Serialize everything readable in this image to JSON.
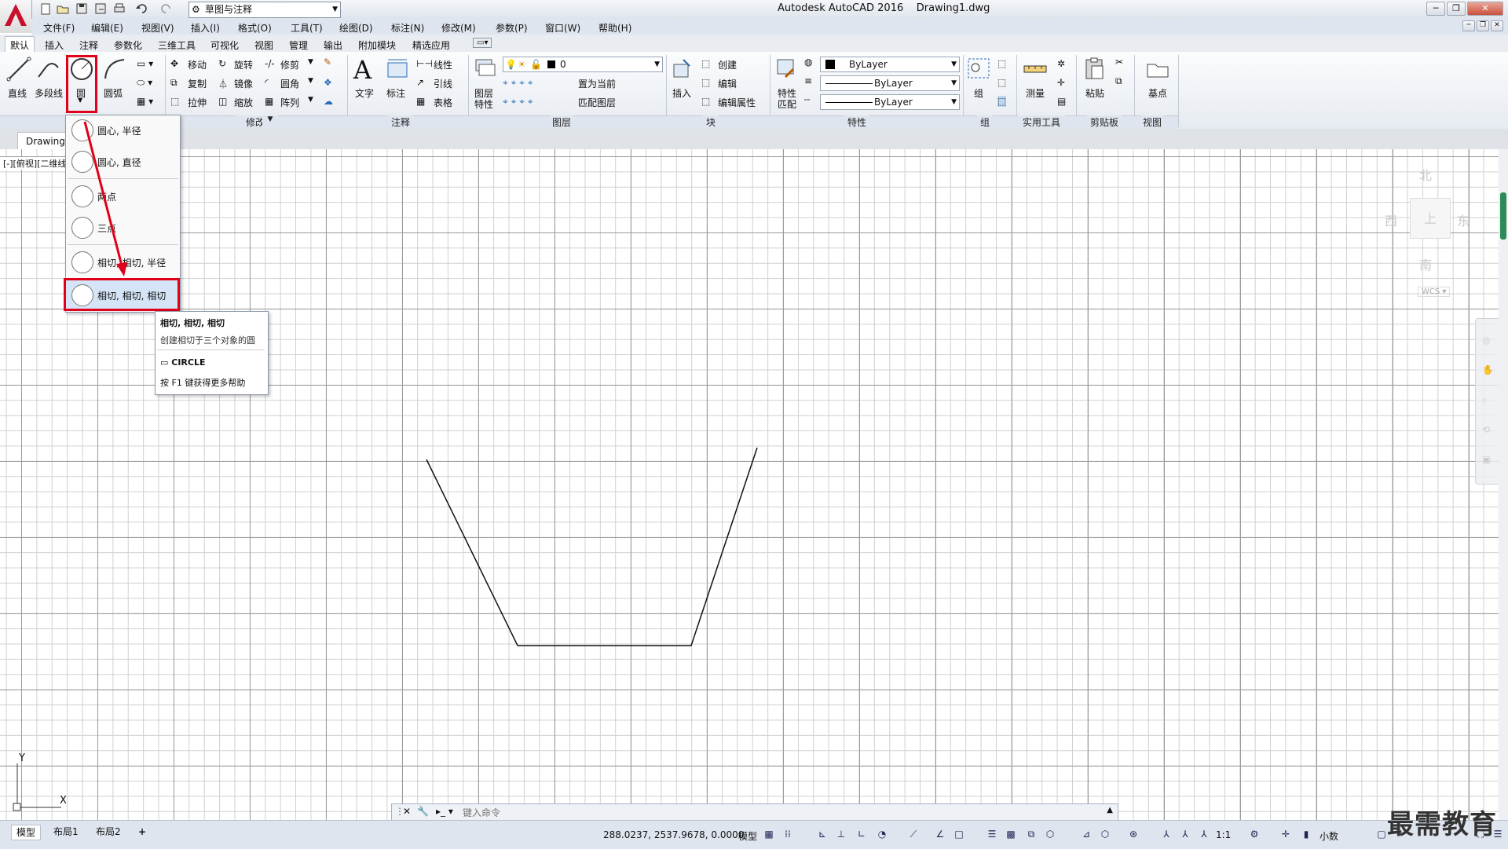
{
  "window": {
    "app_title": "Autodesk AutoCAD 2016",
    "file_name": "Drawing1.dwg",
    "workspace": "草图与注释"
  },
  "menu": [
    "文件(F)",
    "编辑(E)",
    "视图(V)",
    "插入(I)",
    "格式(O)",
    "工具(T)",
    "绘图(D)",
    "标注(N)",
    "修改(M)",
    "参数(P)",
    "窗口(W)",
    "帮助(H)"
  ],
  "ribbon_tabs": [
    "默认",
    "插入",
    "注释",
    "参数化",
    "三维工具",
    "可视化",
    "视图",
    "管理",
    "输出",
    "附加模块",
    "精选应用"
  ],
  "draw": {
    "line": "直线",
    "polyline": "多段线",
    "circle": "圆",
    "arc": "圆弧"
  },
  "modify": {
    "move": "移动",
    "rotate": "旋转",
    "trim": "修剪",
    "copy": "复制",
    "mirror": "镜像",
    "fillet": "圆角",
    "stretch": "拉伸",
    "scale": "缩放",
    "array": "阵列",
    "title": "修改"
  },
  "annotation": {
    "text": "文字",
    "dimension": "标注",
    "linear": "线性",
    "leader": "引线",
    "table": "表格",
    "title": "注释"
  },
  "layers": {
    "props": "图层",
    "props2": "特性",
    "current_layer": "0",
    "set_current": "置为当前",
    "match_layer": "匹配图层",
    "title": "图层"
  },
  "block": {
    "insert": "插入",
    "create": "创建",
    "edit": "编辑",
    "edit_attr": "编辑属性",
    "title": "块"
  },
  "properties": {
    "match": "特性",
    "match2": "匹配",
    "color": "ByLayer",
    "linetype": "ByLayer",
    "lineweight": "ByLayer",
    "title": "特性"
  },
  "group": {
    "label": "组",
    "title": "组"
  },
  "utilities": {
    "measure": "测量",
    "title": "实用工具"
  },
  "clipboard": {
    "paste": "粘贴",
    "title": "剪贴板"
  },
  "view": {
    "base": "基点",
    "title": "视图"
  },
  "doc_tab": "Drawing1",
  "view_label": "[-][俯视][二维线框]",
  "circle_menu": {
    "items": [
      "圆心, 半径",
      "圆心, 直径",
      "两点",
      "三点",
      "相切, 相切, 半径",
      "相切, 相切, 相切"
    ]
  },
  "tooltip": {
    "title": "相切, 相切, 相切",
    "desc": "创建相切于三个对象的圆",
    "command": "CIRCLE",
    "help": "按 F1 键获得更多帮助"
  },
  "viewcube": {
    "north": "北",
    "south": "南",
    "east": "东",
    "west": "西",
    "top": "上",
    "wcs": "WCS"
  },
  "command_line": {
    "placeholder": "键入命令"
  },
  "layouts": [
    "模型",
    "布局1",
    "布局2"
  ],
  "status": {
    "coords": "288.0237, 2537.9678, 0.0000",
    "model": "模型",
    "scale": "1:1",
    "units": "小数"
  },
  "watermark": "最需教育",
  "ucs": {
    "x": "X",
    "y": "Y"
  },
  "colors": {
    "highlight": "#e0001a",
    "accent": "#2e8b57"
  }
}
